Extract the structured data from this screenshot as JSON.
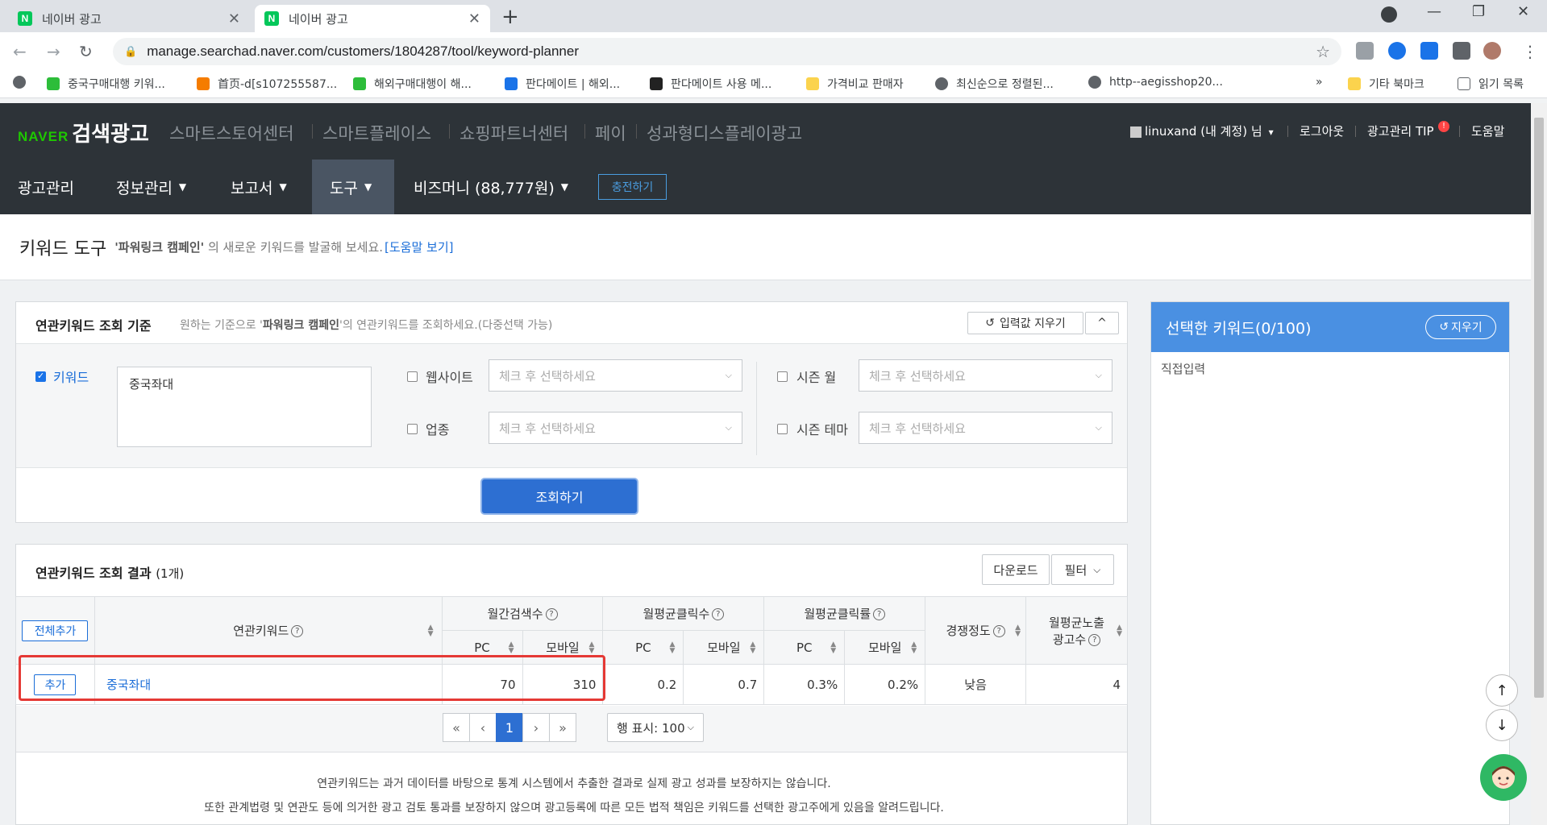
{
  "browser": {
    "tabs": [
      {
        "title": "네이버 광고",
        "favicon": "N"
      },
      {
        "title": "네이버 광고",
        "favicon": "N"
      }
    ],
    "url": "manage.searchad.naver.com/customers/1804287/tool/keyword-planner",
    "bookmarks": [
      "중국구매대행 키워...",
      "首页-d[s107255587...",
      "해외구매대행이 해...",
      "판다메이트 | 해외...",
      "판다메이트 사용 메...",
      "가격비교 판매자",
      "최신순으로 정렬된...",
      "http--aegisshop20..."
    ],
    "bookmarks_more": "»",
    "bookmarks_other": "기타 북마크",
    "reading_list": "읽기 목록"
  },
  "header": {
    "brand_naver": "NAVER",
    "brand_service": "검색광고",
    "top_links": [
      "스마트스토어센터",
      "스마트플레이스",
      "쇼핑파트너센터",
      "페이",
      "성과형디스플레이광고"
    ],
    "user": "linuxand (내 계정) 님",
    "logout": "로그아웃",
    "tip": "광고관리 TIP",
    "tip_badge": "!",
    "help": "도움말"
  },
  "mainnav": {
    "items": [
      "광고관리",
      "정보관리",
      "보고서",
      "도구",
      "비즈머니 (88,777원)"
    ],
    "charge": "충전하기"
  },
  "page": {
    "title": "키워드 도구",
    "desc_pre": "'파워링크 캠페인'",
    "desc_post": " 의 새로운 키워드를 발굴해 보세요.",
    "help_link": "[도움말 보기]"
  },
  "criteria": {
    "title": "연관키워드 조회 기준",
    "desc_pre": "원하는 기준으로 '",
    "desc_bold": "파워링크 캠페인",
    "desc_post": "'의 연관키워드를 조회하세요.(다중선택 가능)",
    "clear_input": "입력값 지우기",
    "collapse": "^",
    "keyword_label": "키워드",
    "keyword_value": "중국좌대",
    "website_label": "웹사이트",
    "industry_label": "업종",
    "season_month_label": "시즌 월",
    "season_theme_label": "시즌 테마",
    "select_placeholder": "체크 후 선택하세요",
    "search_button": "조회하기"
  },
  "results": {
    "title": "연관키워드 조회 결과",
    "count": "(1개)",
    "download": "다운로드",
    "filter": "필터",
    "add_all": "전체추가",
    "headers": {
      "keyword": "연관키워드",
      "monthly_search": "월간검색수",
      "avg_clicks": "월평균클릭수",
      "avg_ctr": "월평균클릭률",
      "competition": "경쟁정도",
      "avg_ads_line1": "월평균노출",
      "avg_ads_line2": "광고수",
      "pc": "PC",
      "mobile": "모바일"
    },
    "rows": [
      {
        "add": "추가",
        "keyword": "중국좌대",
        "search_pc": "70",
        "search_mobile": "310",
        "clicks_pc": "0.2",
        "clicks_mobile": "0.7",
        "ctr_pc": "0.3%",
        "ctr_mobile": "0.2%",
        "competition": "낮음",
        "ads": "4"
      }
    ],
    "pager": {
      "first": "«",
      "prev": "‹",
      "current": "1",
      "next": "›",
      "last": "»"
    },
    "rows_per_page": "행 표시: 100",
    "notice1": "연관키워드는 과거 데이터를 바탕으로 통계 시스템에서 추출한 결과로 실제 광고 성과를 보장하지는 않습니다.",
    "notice2": "또한 관계법령 및 연관도 등에 의거한 광고 검토 통과를 보장하지 않으며 광고등록에 따른 모든 법적 책임은 키워드를 선택한 광고주에게 있음을 알려드립니다."
  },
  "selected": {
    "title": "선택한 키워드(0/100)",
    "clear": "지우기",
    "direct_input": "직접입력"
  },
  "colors": {
    "header_bg": "#2d3338",
    "accent_blue": "#2d6fd2",
    "panel_blue": "#4a90e2",
    "naver_green": "#1ec800",
    "highlight_red": "#e53935"
  }
}
